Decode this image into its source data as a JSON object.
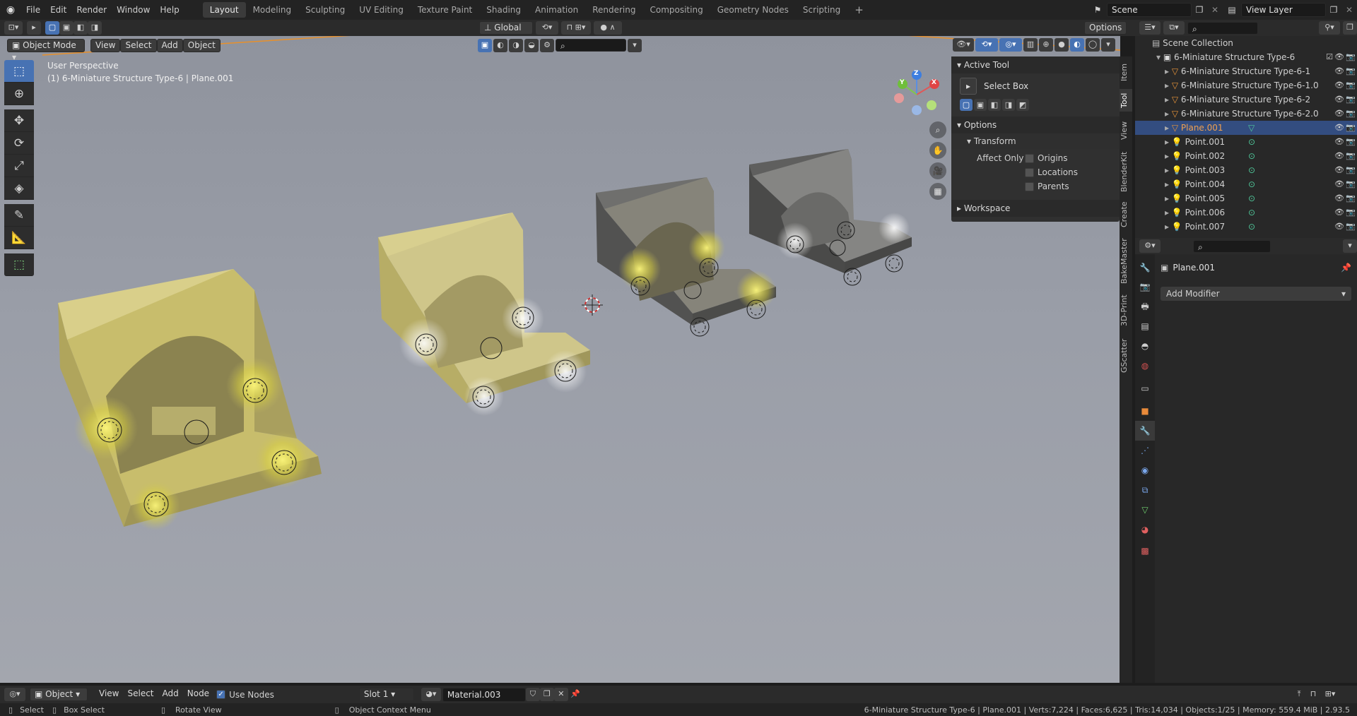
{
  "topbar": {
    "menus": [
      "File",
      "Edit",
      "Render",
      "Window",
      "Help"
    ],
    "workspaces": [
      "Layout",
      "Modeling",
      "Sculpting",
      "UV Editing",
      "Texture Paint",
      "Shading",
      "Animation",
      "Rendering",
      "Compositing",
      "Geometry Nodes",
      "Scripting"
    ],
    "add_workspace": "+",
    "scene": "Scene",
    "view_layer": "View Layer"
  },
  "viewport_header": {
    "mode": "Object Mode",
    "menus": [
      "View",
      "Select",
      "Add",
      "Object"
    ],
    "orientation": "Global",
    "options": "Options"
  },
  "viewport": {
    "perspective": "User Perspective",
    "context": "(1) 6-Miniature Structure Type-6 | Plane.001",
    "gizmo": {
      "x": "X",
      "y": "Y",
      "z": "Z"
    }
  },
  "npanel": {
    "active_tool_header": "Active Tool",
    "tool_name": "Select Box",
    "options_header": "Options",
    "transform_header": "Transform",
    "affect_only": "Affect Only",
    "origins": "Origins",
    "locations": "Locations",
    "parents": "Parents",
    "workspace_header": "Workspace",
    "tabs": [
      "Item",
      "Tool",
      "View",
      "BlenderKit",
      "Create",
      "BakeMaster",
      "3D-Print",
      "GScatter"
    ]
  },
  "outliner": {
    "root": "Scene Collection",
    "collection": "6-Miniature Structure Type-6",
    "items": [
      {
        "name": "6-Miniature Structure Type-6-1",
        "kind": "mesh"
      },
      {
        "name": "6-Miniature Structure Type-6-1.0",
        "kind": "mesh"
      },
      {
        "name": "6-Miniature Structure Type-6-2",
        "kind": "mesh"
      },
      {
        "name": "6-Miniature Structure Type-6-2.0",
        "kind": "mesh"
      },
      {
        "name": "Plane.001",
        "kind": "mesh",
        "selected": true
      },
      {
        "name": "Point.001",
        "kind": "light"
      },
      {
        "name": "Point.002",
        "kind": "light"
      },
      {
        "name": "Point.003",
        "kind": "light"
      },
      {
        "name": "Point.004",
        "kind": "light"
      },
      {
        "name": "Point.005",
        "kind": "light"
      },
      {
        "name": "Point.006",
        "kind": "light"
      },
      {
        "name": "Point.007",
        "kind": "light"
      }
    ]
  },
  "properties": {
    "object_name": "Plane.001",
    "add_modifier": "Add Modifier"
  },
  "shader_header": {
    "type": "Object",
    "menus": [
      "View",
      "Select",
      "Add",
      "Node"
    ],
    "use_nodes": "Use Nodes",
    "slot": "Slot 1",
    "material": "Material.003"
  },
  "status": {
    "select": "Select",
    "box_select": "Box Select",
    "rotate_view": "Rotate View",
    "context_menu": "Object Context Menu",
    "stats": "6-Miniature Structure Type-6 | Plane.001 | Verts:7,224 | Faces:6,625 | Tris:14,034 | Objects:1/25 | Memory: 559.4 MiB | 2.93.5"
  },
  "colors": {
    "accent": "#4772b3",
    "selected_row": "#334d80",
    "viewport_bg": "#9a9ea8",
    "light_glow": "#e8e04a"
  }
}
